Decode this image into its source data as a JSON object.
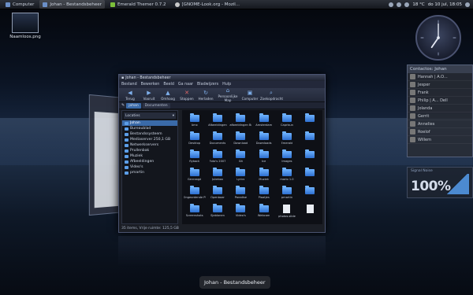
{
  "top_panel": {
    "tasks": [
      {
        "label": "Computer"
      },
      {
        "label": "Johan - Bestandsbeheer"
      },
      {
        "label": "Emerald Themer 0.7.2"
      },
      {
        "label": "[GNOME-Look.org - Mozil..."
      }
    ],
    "tray": {
      "weather": "18 °C",
      "datetime": "do 10 jul, 18:05"
    }
  },
  "desktop_icon": {
    "label": "Naamloos.png"
  },
  "contacts": {
    "title": "Contactos: Johan",
    "rows": [
      "Hannah | A.O...",
      "Jesper",
      "Frank",
      "Philip | A... Dell",
      "Jolanda",
      "Gerrit",
      "Annelies",
      "Roelof",
      "Willem"
    ]
  },
  "signal": {
    "tag": "Signal   Noise",
    "value": "100%"
  },
  "file_manager": {
    "title": "Johan - Bestandsbeheer",
    "menus": [
      "Bestand",
      "Bewerken",
      "Beeld",
      "Ga naar",
      "Bladwijzers",
      "Hulp"
    ],
    "toolbar": [
      "Terug",
      "Vooruit",
      "Omhoog",
      "Stoppen",
      "Herladen",
      "Persoonlijke Map",
      "Computer",
      "Zoekopdracht"
    ],
    "location": [
      "johan",
      "Documenten"
    ],
    "side_combo": "Locaties",
    "places": [
      "Johan",
      "Bureaublad",
      "Bestandssysteem",
      "Mediaserver 250,1 GB",
      "Netwerkservers",
      "Prullenbak",
      "Muziek",
      "Afbeeldingen",
      "Video's",
      "pmartin"
    ],
    "items": [
      {
        "name": "Amx",
        "kind": "folder"
      },
      {
        "name": "Afbeeldingen",
        "kind": "folder"
      },
      {
        "name": "afbeeldingen Bewegen",
        "kind": "folder"
      },
      {
        "name": "Amsterdam",
        "kind": "folder"
      },
      {
        "name": "Caprisun",
        "kind": "folder"
      },
      {
        "name": "",
        "kind": "folder"
      },
      {
        "name": "Desktop",
        "kind": "folder"
      },
      {
        "name": "Documents",
        "kind": "folder"
      },
      {
        "name": "Download",
        "kind": "folder"
      },
      {
        "name": "Downloads",
        "kind": "folder"
      },
      {
        "name": "Emerald",
        "kind": "folder"
      },
      {
        "name": "",
        "kind": "folder"
      },
      {
        "name": "flyback",
        "kind": "folder"
      },
      {
        "name": "Foto's 2007",
        "kind": "folder"
      },
      {
        "name": "Git",
        "kind": "folder"
      },
      {
        "name": "Ice",
        "kind": "folder"
      },
      {
        "name": "Images",
        "kind": "folder"
      },
      {
        "name": "",
        "kind": "folder"
      },
      {
        "name": "Gevraagd",
        "kind": "folder"
      },
      {
        "name": "Jukebox",
        "kind": "folder"
      },
      {
        "name": "Lyrics",
        "kind": "folder"
      },
      {
        "name": "Muziek",
        "kind": "folder"
      },
      {
        "name": "mario 1.0",
        "kind": "folder"
      },
      {
        "name": "",
        "kind": "folder"
      },
      {
        "name": "Ongeordende Plaatjes",
        "kind": "folder"
      },
      {
        "name": "Openbaar",
        "kind": "folder"
      },
      {
        "name": "Paradise",
        "kind": "folder"
      },
      {
        "name": "Plaatjes",
        "kind": "folder"
      },
      {
        "name": "pmartin",
        "kind": "folder"
      },
      {
        "name": "",
        "kind": "folder"
      },
      {
        "name": "Screenshots",
        "kind": "folder"
      },
      {
        "name": "Sjablonen",
        "kind": "folder"
      },
      {
        "name": "Video's",
        "kind": "folder"
      },
      {
        "name": "Webcam",
        "kind": "folder"
      },
      {
        "name": "photos.slide",
        "kind": "file"
      },
      {
        "name": "",
        "kind": "file"
      }
    ],
    "status": "35 items, Vrije ruimte: 125,5 GB"
  },
  "caption": "Johan - Bestandsbeheer",
  "colors": {
    "accent": "#3a6aa8",
    "folder": "#4c94f0"
  }
}
